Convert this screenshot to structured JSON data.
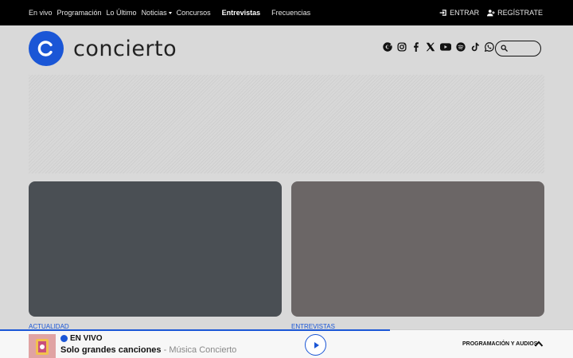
{
  "nav": {
    "links": [
      {
        "label": "En vivo"
      },
      {
        "label": "Programación"
      },
      {
        "label": "Lo Último"
      },
      {
        "label": "Noticias"
      },
      {
        "label": "Concursos"
      },
      {
        "label": "Entrevistas"
      },
      {
        "label": "Frecuencias"
      }
    ],
    "login_label": "ENTRAR",
    "register_label": "REGÍSTRATE"
  },
  "header": {
    "logo_letter": "C",
    "logo_text": "concierto",
    "social_icons": [
      "google-icon",
      "instagram-icon",
      "facebook-icon",
      "x-icon",
      "youtube-icon",
      "spotify-icon",
      "tiktok-icon",
      "whatsapp-icon"
    ],
    "search_icon": "search-icon"
  },
  "cards": [
    {
      "category": "ACTUALIDAD",
      "color": "#4a4f54"
    },
    {
      "category": "ENTREVISTAS",
      "color": "#6b6666"
    }
  ],
  "player": {
    "live_label": "EN VIVO",
    "title": "Solo grandes canciones",
    "separator": " - ",
    "subtitle": "Música Concierto",
    "programming_label": "PROGRAMACIÓN Y AUDIOS",
    "progress": 0.68,
    "accent": "#1a56d6"
  }
}
